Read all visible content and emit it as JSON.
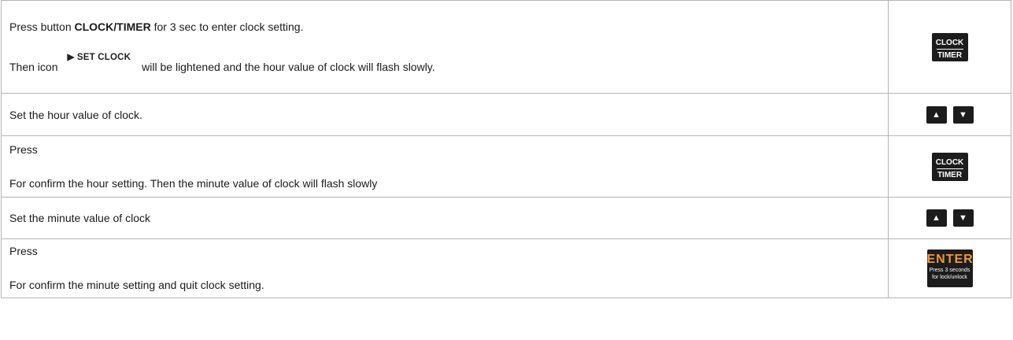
{
  "rows": [
    {
      "line1_pre": "Press button ",
      "line1_bold": "CLOCK/TIMER",
      "line1_post": " for 3 sec to enter clock setting.",
      "line2_pre": "Then icon",
      "line2_icon": "▶ SET CLOCK",
      "line2_post": "will be lightened and the hour value of clock will flash slowly.",
      "key": {
        "top": "CLOCK",
        "bottom": "TIMER"
      }
    },
    {
      "text": "Set the hour value of clock.",
      "keys": [
        "▲",
        "▼"
      ]
    },
    {
      "line1": "Press",
      "line2": "For confirm the hour setting. Then the minute value of clock will flash slowly",
      "key": {
        "top": "CLOCK",
        "bottom": "TIMER"
      }
    },
    {
      "text": "Set the minute value of clock",
      "keys": [
        "▲",
        "▼"
      ]
    },
    {
      "line1": "Press",
      "line2": "For confirm the minute setting and quit clock setting.",
      "key": {
        "big": "ENTER",
        "small1": "Press 3 seconds",
        "small2": "for lock/unlock"
      }
    }
  ],
  "colors": {
    "border": "#b5b5b5",
    "key_bg": "#1c1c1c",
    "enter_accent": "#f39a2e"
  }
}
